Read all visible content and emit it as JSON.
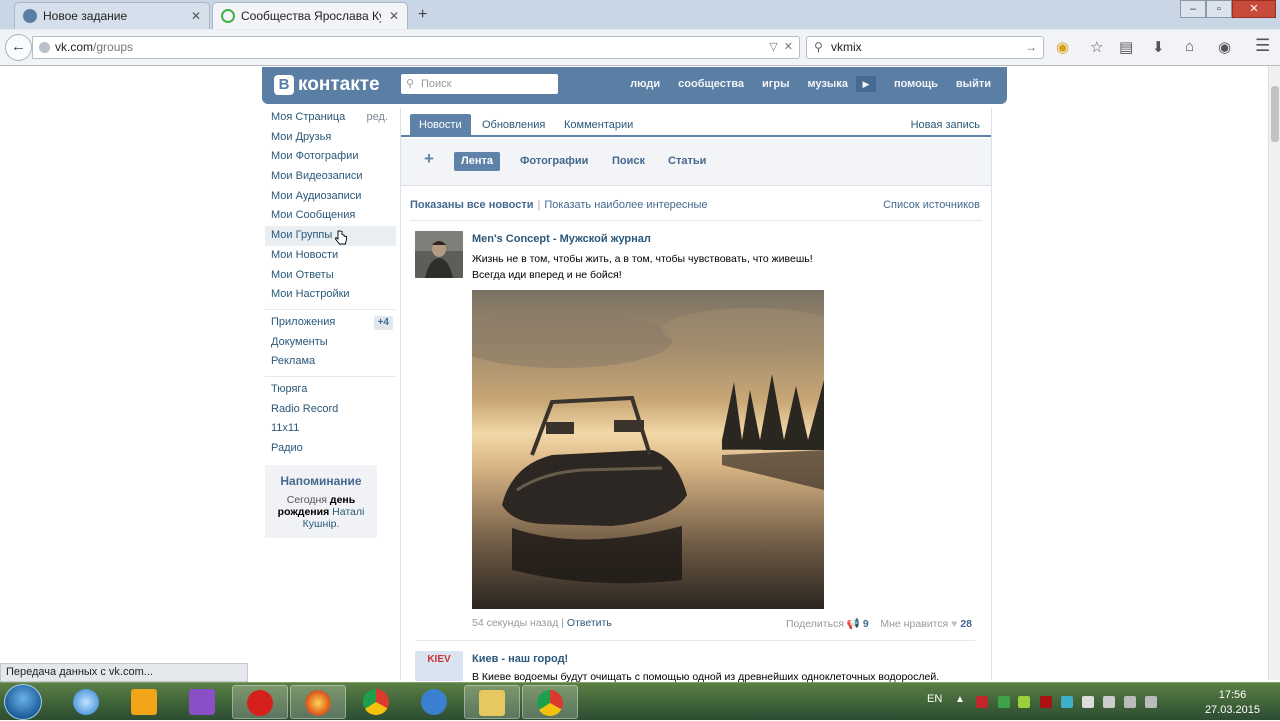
{
  "browser": {
    "tabs": [
      {
        "title": "Новое задание",
        "favicon_color": "#5b7ea5",
        "active": false
      },
      {
        "title": "Сообщества Ярослава Ку...",
        "favicon_color": "#3fb04a",
        "active": true
      }
    ],
    "new_tab_symbol": "+",
    "url": {
      "host": "vk.com",
      "path": "/groups"
    },
    "search_value": "vkmix",
    "status_text": "Передача данных с vk.com...",
    "window_controls": [
      "–",
      "▫",
      "✕"
    ]
  },
  "vk": {
    "logo_text": "контакте",
    "logo_b": "В",
    "search_placeholder": "Поиск",
    "nav": [
      "люди",
      "сообщества",
      "игры",
      "музыка",
      "помощь",
      "выйти"
    ],
    "play_symbol": "▶",
    "left_menu": {
      "edit_label": "ред.",
      "group1": [
        "Моя Страница",
        "Мои Друзья",
        "Мои Фотографии",
        "Мои Видеозаписи",
        "Мои Аудиозаписи",
        "Мои Сообщения",
        "Мои Группы",
        "Мои Новости",
        "Мои Ответы",
        "Мои Настройки"
      ],
      "group2": [
        "Приложения",
        "Документы",
        "Реклама"
      ],
      "apps_count": "+4",
      "group3": [
        "Тюряга",
        "Radio Record",
        "11x11",
        "Радио"
      ]
    },
    "reminder": {
      "title": "Напоминание",
      "text1": "Сегодня",
      "bold": "день рождения",
      "name": "Наталі Кушнір",
      "end": "."
    },
    "tabs": [
      "Новости",
      "Обновления",
      "Комментарии"
    ],
    "new_post": "Новая запись",
    "subtabs": [
      "Лента",
      "Фотографии",
      "Поиск",
      "Статьи"
    ],
    "filter": {
      "all": "Показаны все новости",
      "interesting": "Показать наиболее интересные",
      "sources": "Список источников"
    },
    "post1": {
      "author": "Men's Concept - Мужской журнал",
      "line1": "Жизнь не в том, чтобы жить, а в том, чтобы чувствовать, что живешь!",
      "line2": "Всегда иди вперед и не бойся!",
      "time": "54 секунды назад",
      "reply": "Ответить",
      "share": "Поделиться",
      "share_count": "9",
      "like": "Мне нравится",
      "like_count": "28"
    },
    "post2": {
      "author": "Киев - наш город!",
      "line1": "В Киеве водоемы будут очищать с помощью одной из древнейших одноклеточных водорослей.",
      "ava_text": "KIEV"
    }
  },
  "taskbar": {
    "lang": "EN",
    "time": "17:56",
    "date": "27.03.2015"
  }
}
